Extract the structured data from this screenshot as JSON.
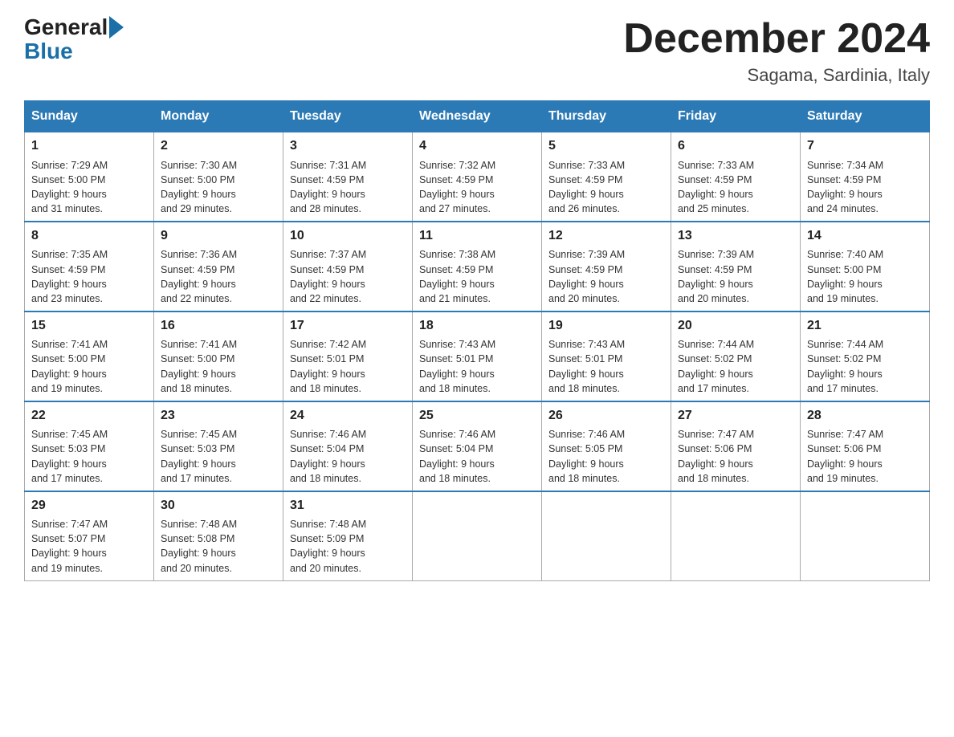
{
  "header": {
    "logo_general": "General",
    "logo_blue": "Blue",
    "month_title": "December 2024",
    "location": "Sagama, Sardinia, Italy"
  },
  "days_of_week": [
    "Sunday",
    "Monday",
    "Tuesday",
    "Wednesday",
    "Thursday",
    "Friday",
    "Saturday"
  ],
  "weeks": [
    [
      {
        "day": "1",
        "sunrise": "7:29 AM",
        "sunset": "5:00 PM",
        "daylight": "9 hours and 31 minutes."
      },
      {
        "day": "2",
        "sunrise": "7:30 AM",
        "sunset": "5:00 PM",
        "daylight": "9 hours and 29 minutes."
      },
      {
        "day": "3",
        "sunrise": "7:31 AM",
        "sunset": "4:59 PM",
        "daylight": "9 hours and 28 minutes."
      },
      {
        "day": "4",
        "sunrise": "7:32 AM",
        "sunset": "4:59 PM",
        "daylight": "9 hours and 27 minutes."
      },
      {
        "day": "5",
        "sunrise": "7:33 AM",
        "sunset": "4:59 PM",
        "daylight": "9 hours and 26 minutes."
      },
      {
        "day": "6",
        "sunrise": "7:33 AM",
        "sunset": "4:59 PM",
        "daylight": "9 hours and 25 minutes."
      },
      {
        "day": "7",
        "sunrise": "7:34 AM",
        "sunset": "4:59 PM",
        "daylight": "9 hours and 24 minutes."
      }
    ],
    [
      {
        "day": "8",
        "sunrise": "7:35 AM",
        "sunset": "4:59 PM",
        "daylight": "9 hours and 23 minutes."
      },
      {
        "day": "9",
        "sunrise": "7:36 AM",
        "sunset": "4:59 PM",
        "daylight": "9 hours and 22 minutes."
      },
      {
        "day": "10",
        "sunrise": "7:37 AM",
        "sunset": "4:59 PM",
        "daylight": "9 hours and 22 minutes."
      },
      {
        "day": "11",
        "sunrise": "7:38 AM",
        "sunset": "4:59 PM",
        "daylight": "9 hours and 21 minutes."
      },
      {
        "day": "12",
        "sunrise": "7:39 AM",
        "sunset": "4:59 PM",
        "daylight": "9 hours and 20 minutes."
      },
      {
        "day": "13",
        "sunrise": "7:39 AM",
        "sunset": "4:59 PM",
        "daylight": "9 hours and 20 minutes."
      },
      {
        "day": "14",
        "sunrise": "7:40 AM",
        "sunset": "5:00 PM",
        "daylight": "9 hours and 19 minutes."
      }
    ],
    [
      {
        "day": "15",
        "sunrise": "7:41 AM",
        "sunset": "5:00 PM",
        "daylight": "9 hours and 19 minutes."
      },
      {
        "day": "16",
        "sunrise": "7:41 AM",
        "sunset": "5:00 PM",
        "daylight": "9 hours and 18 minutes."
      },
      {
        "day": "17",
        "sunrise": "7:42 AM",
        "sunset": "5:01 PM",
        "daylight": "9 hours and 18 minutes."
      },
      {
        "day": "18",
        "sunrise": "7:43 AM",
        "sunset": "5:01 PM",
        "daylight": "9 hours and 18 minutes."
      },
      {
        "day": "19",
        "sunrise": "7:43 AM",
        "sunset": "5:01 PM",
        "daylight": "9 hours and 18 minutes."
      },
      {
        "day": "20",
        "sunrise": "7:44 AM",
        "sunset": "5:02 PM",
        "daylight": "9 hours and 17 minutes."
      },
      {
        "day": "21",
        "sunrise": "7:44 AM",
        "sunset": "5:02 PM",
        "daylight": "9 hours and 17 minutes."
      }
    ],
    [
      {
        "day": "22",
        "sunrise": "7:45 AM",
        "sunset": "5:03 PM",
        "daylight": "9 hours and 17 minutes."
      },
      {
        "day": "23",
        "sunrise": "7:45 AM",
        "sunset": "5:03 PM",
        "daylight": "9 hours and 17 minutes."
      },
      {
        "day": "24",
        "sunrise": "7:46 AM",
        "sunset": "5:04 PM",
        "daylight": "9 hours and 18 minutes."
      },
      {
        "day": "25",
        "sunrise": "7:46 AM",
        "sunset": "5:04 PM",
        "daylight": "9 hours and 18 minutes."
      },
      {
        "day": "26",
        "sunrise": "7:46 AM",
        "sunset": "5:05 PM",
        "daylight": "9 hours and 18 minutes."
      },
      {
        "day": "27",
        "sunrise": "7:47 AM",
        "sunset": "5:06 PM",
        "daylight": "9 hours and 18 minutes."
      },
      {
        "day": "28",
        "sunrise": "7:47 AM",
        "sunset": "5:06 PM",
        "daylight": "9 hours and 19 minutes."
      }
    ],
    [
      {
        "day": "29",
        "sunrise": "7:47 AM",
        "sunset": "5:07 PM",
        "daylight": "9 hours and 19 minutes."
      },
      {
        "day": "30",
        "sunrise": "7:48 AM",
        "sunset": "5:08 PM",
        "daylight": "9 hours and 20 minutes."
      },
      {
        "day": "31",
        "sunrise": "7:48 AM",
        "sunset": "5:09 PM",
        "daylight": "9 hours and 20 minutes."
      },
      null,
      null,
      null,
      null
    ]
  ],
  "labels": {
    "sunrise": "Sunrise:",
    "sunset": "Sunset:",
    "daylight": "Daylight:"
  }
}
